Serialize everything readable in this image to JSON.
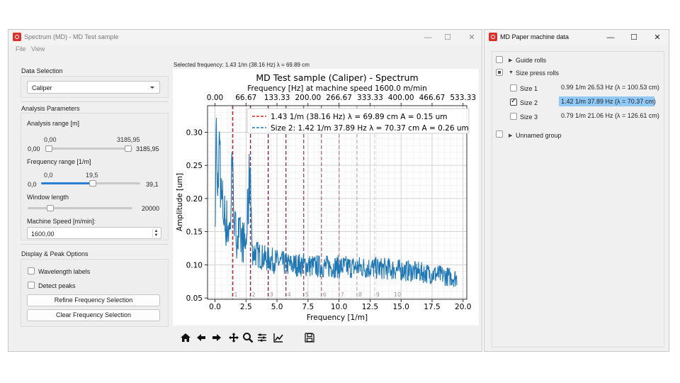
{
  "window_main": {
    "title": "Spectrum (MD) - MD Test sample",
    "menu": [
      "File",
      "View"
    ],
    "controls": {
      "minimize": "—",
      "maximize": "☐",
      "close": "✕"
    },
    "data_selection": {
      "heading": "Data Selection",
      "value": "Caliper"
    },
    "analysis": {
      "heading": "Analysis Parameters",
      "range": {
        "label": "Analysis range [m]",
        "low_top": "0,00",
        "high_top": "3185,95",
        "low": "0,00",
        "high": "3185,95",
        "low_fraction": 0.0,
        "high_fraction": 1.0
      },
      "freq": {
        "label": "Frequency range [1/m]",
        "top_a": "0,0",
        "top_b": "19,5",
        "low": "0,0",
        "high": "39,1",
        "fraction": 0.5
      },
      "window": {
        "label": "Window length",
        "value": "20000",
        "fraction": 0.2
      },
      "speed": {
        "label": "Machine Speed [m/min]:",
        "value": "1600,00"
      }
    },
    "display": {
      "heading": "Display & Peak Options",
      "wavelength_labels": "Wavelength labels",
      "detect_peaks": "Detect peaks",
      "refine_button": "Refine Frequency Selection",
      "clear_button": "Clear Frequency Selection"
    },
    "selected_frequency": "Selected frequency: 1.43 1/m (38.16 Hz) λ = 69.89 cm",
    "toolbar_icons": [
      "home-icon",
      "back-arrow-icon",
      "forward-arrow-icon",
      "pan-icon",
      "zoom-icon",
      "subplots-config-icon",
      "edit-axes-icon",
      "save-icon"
    ]
  },
  "chart_data": {
    "type": "line",
    "title": "MD Test sample (Caliper) - Spectrum",
    "xlabel": "Frequency [1/m]",
    "ylabel": "Amplitude [um]",
    "xlim": [
      -0.6,
      20.3
    ],
    "ylim": [
      0.048,
      0.34
    ],
    "xticks": [
      "0.0",
      "2.5",
      "5.0",
      "7.5",
      "10.0",
      "12.5",
      "15.0",
      "17.5",
      "20.0"
    ],
    "xtick_values": [
      0,
      2.5,
      5,
      7.5,
      10,
      12.5,
      15,
      17.5,
      20
    ],
    "yticks": [
      "0.05",
      "0.10",
      "0.15",
      "0.20",
      "0.25",
      "0.30"
    ],
    "ytick_values": [
      0.05,
      0.1,
      0.15,
      0.2,
      0.25,
      0.3
    ],
    "top_axis_label": "Frequency [Hz] at machine speed 1600.0 m/min",
    "top_ticks": [
      "0.00",
      "66.67",
      "133.33",
      "200.00",
      "266.67",
      "333.33",
      "400.00",
      "466.67",
      "533.33"
    ],
    "grid": true,
    "legend_position": "top-right",
    "legend": [
      {
        "label": "1.43 1/m (38.16 Hz) λ = 69.89 cm A = 0.15 um",
        "color": "#d62728"
      },
      {
        "label": "Size 2: 1.42 1/m 37.89 Hz λ = 70.37 cm A = 0.26 um",
        "color": "#1f77b4"
      }
    ],
    "series_color": "#1f77b4",
    "spectrum_envelope": {
      "x": [
        0,
        0.1,
        0.2,
        0.35,
        0.5,
        0.8,
        1.0,
        1.2,
        1.42,
        1.6,
        2.0,
        2.5,
        2.85,
        3.0,
        4.0,
        5.0,
        6.0,
        7.0,
        8.0,
        10.0,
        12.0,
        14.0,
        16.0,
        18.0,
        19.5
      ],
      "y": [
        0.13,
        0.34,
        0.18,
        0.31,
        0.2,
        0.17,
        0.16,
        0.15,
        0.26,
        0.15,
        0.14,
        0.13,
        0.25,
        0.12,
        0.11,
        0.105,
        0.1,
        0.1,
        0.098,
        0.097,
        0.096,
        0.094,
        0.09,
        0.085,
        0.08
      ]
    },
    "marker_lines": [
      {
        "x": 1.42,
        "color": "#1f77b4"
      },
      {
        "x": 1.43,
        "color": "#d62728"
      },
      {
        "x": 2.86,
        "color": "#7b1f58"
      },
      {
        "x": 4.29,
        "color": "#7b1f58"
      },
      {
        "x": 5.72,
        "color": "#8a3a6a"
      },
      {
        "x": 7.15,
        "color": "#9a4f7a"
      },
      {
        "x": 8.58,
        "color": "#b0708f"
      },
      {
        "x": 10.01,
        "color": "#c08ba3"
      },
      {
        "x": 11.44,
        "color": "#d4b0c0"
      },
      {
        "x": 12.87,
        "color": "#e2cfd8"
      }
    ],
    "harmonic_labels": [
      "1",
      "2",
      "3",
      "4",
      "5",
      "6",
      "7",
      "8",
      "9",
      "10"
    ],
    "harmonic_x": [
      1.43,
      2.86,
      4.29,
      5.72,
      7.15,
      8.58,
      10.01,
      11.44,
      12.87,
      14.3
    ]
  },
  "window_side": {
    "title": "MD Paper machine data",
    "controls": {
      "minimize": "—",
      "maximize": "☐",
      "close": "✕"
    },
    "tree": [
      {
        "label": "Guide rolls",
        "expanded": false,
        "checked": false
      },
      {
        "label": "Size press rolls",
        "expanded": true,
        "checked": "partial",
        "children": [
          {
            "label": "Size 1",
            "value": "0.99 1/m 26.53 Hz (λ = 100.53 cm)",
            "checked": false
          },
          {
            "label": "Size 2",
            "value": "1.42 1/m 37.89 Hz (λ = 70.37 cm)",
            "checked": true
          },
          {
            "label": "Size 3",
            "value": "0.79 1/m 21.06 Hz (λ = 126.61 cm)",
            "checked": false
          }
        ]
      },
      {
        "label": "Unnamed group",
        "expanded": false,
        "checked": false
      }
    ]
  }
}
